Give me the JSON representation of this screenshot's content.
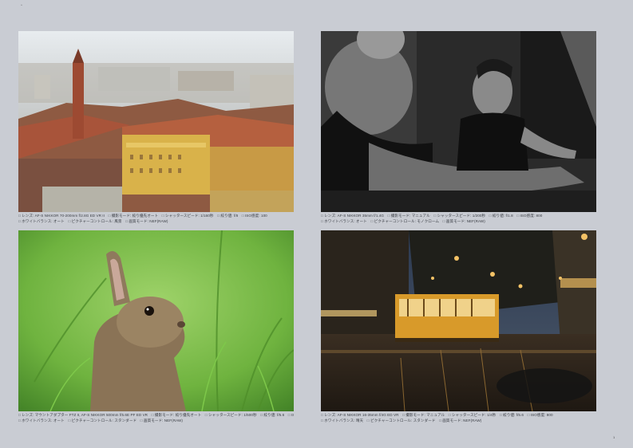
{
  "captions": {
    "p1": {
      "line1": "□ レンズ: AF-S NIKKOR 70-200mm f/2.8G ED VR II　□ 撮影モード: 絞り優先オート　□ シャッタースピード: 1/160秒　□ 絞り値: f/8　□ ISO感度: 100",
      "line2": "□ ホワイトバランス: オート　□ ピクチャーコントロール: 風景　□ 画質モード: NEF(RAW)"
    },
    "p2": {
      "line1": "□ レンズ: AF-S NIKKOR 35mm f/1.4G　□ 撮影モード: マニュアル　□ シャッタースピード: 1/200秒　□ 絞り値: f/1.8　□ ISO感度: 800",
      "line2": "□ ホワイトバランス: オート　□ ピクチャーコントロール: モノクローム　□ 画質モード: NEF(RAW)"
    },
    "p3": {
      "line1": "□ レンズ: マウントアダプター FTZ II, AF-S NIKKOR 500mm f/5.6E PF ED VR　□ 撮影モード: 絞り優先オート　□ シャッタースピード: 1/500秒　□ 絞り値: f/5.6　□ ISO感度: 400",
      "line2": "□ ホワイトバランス: オート　□ ピクチャーコントロール: スタンダード　□ 画質モード: NEF(RAW)"
    },
    "p4": {
      "line1": "□ レンズ: AF-S NIKKOR 16-35mm f/4G ED VR　□ 撮影モード: マニュアル　□ シャッタースピード: 1/4秒　□ 絞り値: f/5.6　□ ISO感度: 800",
      "line2": "□ ホワイトバランス: 晴天　□ ピクチャーコントロール: スタンダード　□ 画質モード: NEF(RAW)"
    }
  },
  "page_number": "1",
  "corner_mark": "^"
}
